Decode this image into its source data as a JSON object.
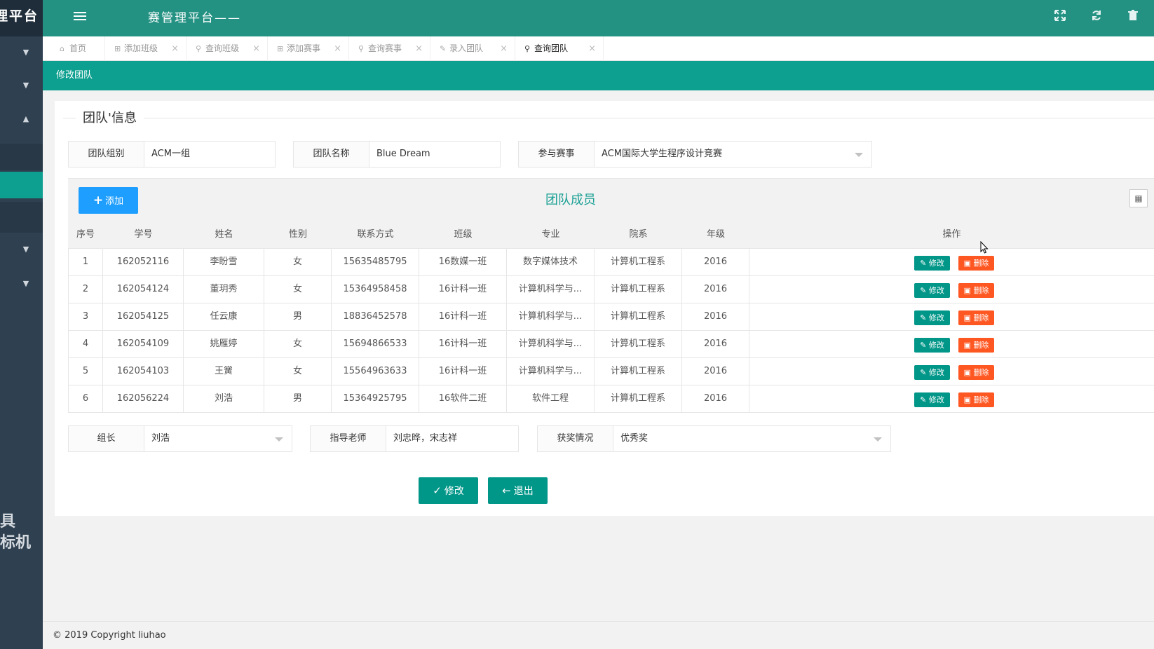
{
  "sidebar": {
    "brand_text": "理平台",
    "watermark_lines": [
      "具",
      "标机"
    ]
  },
  "header": {
    "app_title": "赛管理平台——",
    "icons": [
      "menu-icon",
      "fullscreen-icon",
      "refresh-icon",
      "trash-icon"
    ]
  },
  "tabs": [
    {
      "label": "首页",
      "icon": "home-icon",
      "closable": false
    },
    {
      "label": "添加班级",
      "icon": "plus-square-icon",
      "closable": true
    },
    {
      "label": "查询班级",
      "icon": "search-icon",
      "closable": true
    },
    {
      "label": "添加赛事",
      "icon": "plus-square-icon",
      "closable": true
    },
    {
      "label": "查询赛事",
      "icon": "search-icon",
      "closable": true
    },
    {
      "label": "录入团队",
      "icon": "edit-icon",
      "closable": true
    },
    {
      "label": "查询团队",
      "icon": "search-icon",
      "closable": true,
      "active": true
    }
  ],
  "subheader": {
    "title": "修改团队"
  },
  "form": {
    "legend": "团队'信息",
    "group_label": "团队组别",
    "group_value": "ACM一组",
    "name_label": "团队名称",
    "name_value": "Blue Dream",
    "contest_label": "参与赛事",
    "contest_value": "ACM国际大学生程序设计竞赛",
    "leader_label": "组长",
    "leader_value": "刘浩",
    "teacher_label": "指导老师",
    "teacher_value": "刘忠晔，宋志祥",
    "award_label": "获奖情况",
    "award_value": "优秀奖"
  },
  "members": {
    "add_label": "添加",
    "title": "团队成员",
    "columns": [
      "序号",
      "学号",
      "姓名",
      "性别",
      "联系方式",
      "班级",
      "专业",
      "院系",
      "年级",
      "操作"
    ],
    "edit_label": "修改",
    "delete_label": "删除",
    "rows": [
      [
        "1",
        "162052116",
        "李盼雪",
        "女",
        "15635485795",
        "16数媒一班",
        "数字媒体技术",
        "计算机工程系",
        "2016"
      ],
      [
        "2",
        "162054124",
        "董玥秀",
        "女",
        "15364958458",
        "16计科一班",
        "计算机科学与...",
        "计算机工程系",
        "2016"
      ],
      [
        "3",
        "162054125",
        "任云康",
        "男",
        "18836452578",
        "16计科一班",
        "计算机科学与...",
        "计算机工程系",
        "2016"
      ],
      [
        "4",
        "162054109",
        "姚雁婷",
        "女",
        "15694866533",
        "16计科一班",
        "计算机科学与...",
        "计算机工程系",
        "2016"
      ],
      [
        "5",
        "162054103",
        "王黉",
        "女",
        "15564963633",
        "16计科一班",
        "计算机科学与...",
        "计算机工程系",
        "2016"
      ],
      [
        "6",
        "162056224",
        "刘浩",
        "男",
        "15364925795",
        "16软件二班",
        "软件工程",
        "计算机工程系",
        "2016"
      ]
    ]
  },
  "actions": {
    "submit_label": "修改",
    "exit_label": "退出"
  },
  "footer": {
    "copyright": "© 2019 Copyright liuhao"
  },
  "colors": {
    "header_bg": "#249283",
    "subheader_bg": "#0d9f8f",
    "sidebar_bg": "#2f4050",
    "add_button": "#1e9fff",
    "edit_button": "#009688",
    "delete_button": "#ff5722",
    "title_green": "#1aa094"
  }
}
